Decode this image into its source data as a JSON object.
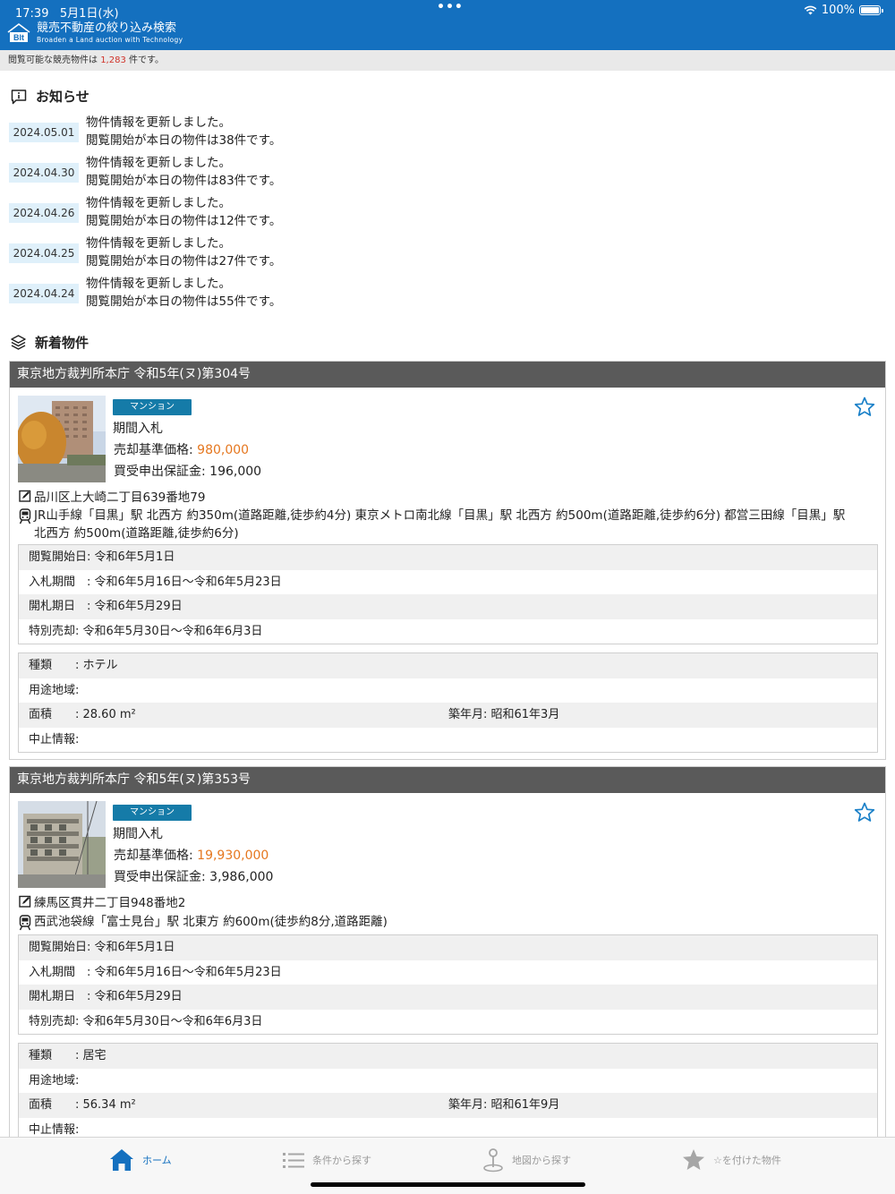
{
  "status_bar": {
    "time": "17:39",
    "date": "5月1日(水)",
    "dots": "•••",
    "battery": "100%"
  },
  "app": {
    "logo_text": "Blt",
    "title": "競売不動産の絞り込み検索",
    "subtitle": "Broaden a Land auction with Technology"
  },
  "count_bar": {
    "prefix": "閲覧可能な競売物件は",
    "count": "1,283",
    "suffix": "件です。"
  },
  "notices": {
    "title": "お知らせ",
    "items": [
      {
        "date": "2024.05.01",
        "line1": "物件情報を更新しました。",
        "line2": "閲覧開始が本日の物件は38件です。"
      },
      {
        "date": "2024.04.30",
        "line1": "物件情報を更新しました。",
        "line2": "閲覧開始が本日の物件は83件です。"
      },
      {
        "date": "2024.04.26",
        "line1": "物件情報を更新しました。",
        "line2": "閲覧開始が本日の物件は12件です。"
      },
      {
        "date": "2024.04.25",
        "line1": "物件情報を更新しました。",
        "line2": "閲覧開始が本日の物件は27件です。"
      },
      {
        "date": "2024.04.24",
        "line1": "物件情報を更新しました。",
        "line2": "閲覧開始が本日の物件は55件です。"
      }
    ]
  },
  "new_listings": {
    "title": "新着物件",
    "cards": [
      {
        "header": "東京地方裁判所本庁 令和5年(ヌ)第304号",
        "badge": "マンション",
        "sale_type": "期間入札",
        "price_label": "売却基準価格:",
        "price": "980,000",
        "deposit": "買受申出保証金: 196,000",
        "address": "品川区上大崎二丁目639番地79",
        "access": "JR山手線「目黒」駅 北西方 約350m(道路距離,徒歩約4分) 東京メトロ南北線「目黒」駅 北西方 約500m(道路距離,徒歩約6分) 都営三田線「目黒」駅 北西方 約500m(道路距離,徒歩約6分)",
        "schedule": [
          "閲覧開始日: 令和6年5月1日",
          "入札期間　: 令和6年5月16日～令和6年5月23日",
          "開札期日　: 令和6年5月29日",
          "特別売却: 令和6年5月30日～令和6年6月3日"
        ],
        "details": {
          "type": "種類　　: ホテル",
          "zoning": "用途地域:",
          "area": "面積　　: 28.60 m²",
          "built": "築年月: 昭和61年3月",
          "suspension": "中止情報:"
        }
      },
      {
        "header": "東京地方裁判所本庁 令和5年(ヌ)第353号",
        "badge": "マンション",
        "sale_type": "期間入札",
        "price_label": "売却基準価格:",
        "price": "19,930,000",
        "deposit": "買受申出保証金: 3,986,000",
        "address": "練馬区貫井二丁目948番地2",
        "access": "西武池袋線「富士見台」駅 北東方 約600m(徒歩約8分,道路距離)",
        "schedule": [
          "閲覧開始日: 令和6年5月1日",
          "入札期間　: 令和6年5月16日～令和6年5月23日",
          "開札期日　: 令和6年5月29日",
          "特別売却: 令和6年5月30日～令和6年6月3日"
        ],
        "details": {
          "type": "種類　　: 居宅",
          "zoning": "用途地域:",
          "area": "面積　　: 56.34 m²",
          "built": "築年月: 昭和61年9月",
          "suspension": "中止情報:"
        }
      }
    ]
  },
  "tabs": [
    {
      "label": "ホーム",
      "icon": "home-icon",
      "active": true
    },
    {
      "label": "条件から探す",
      "icon": "list-icon",
      "active": false
    },
    {
      "label": "地図から探す",
      "icon": "map-pin-icon",
      "active": false
    },
    {
      "label": "☆を付けた物件",
      "icon": "star-icon",
      "active": false
    }
  ],
  "colors": {
    "header": "#1470bf",
    "badge": "#157ba8",
    "price": "#e5771f",
    "count": "#d0332a",
    "date_chip": "#dff0fa"
  }
}
